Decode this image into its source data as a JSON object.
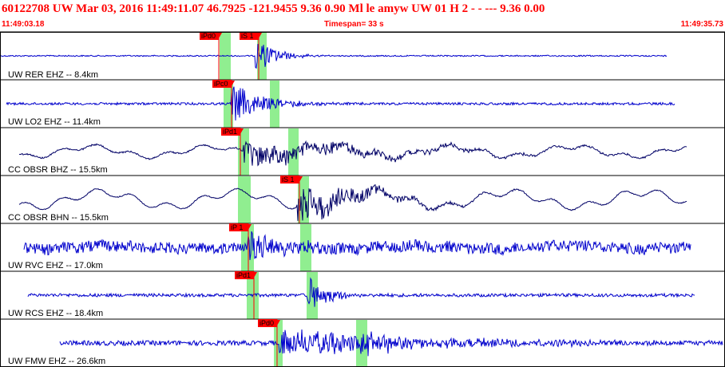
{
  "header": {
    "title": "60122708 UW Mar 03, 2016 11:49:11.07    46.7925 -121.9455  9.36 0.90 Ml le     amyw     UW 01 H    2  -  - ---   9.36 0.00",
    "start_time": "11:49:03.18",
    "timespan": "Timespan=  33 s",
    "end_time": "11:49:35.73"
  },
  "colors": {
    "header_text": "#ff0000",
    "trace_blue": "#0000cc",
    "trace_navy": "#000066",
    "pick_red": "#ff0000",
    "window_green": "#90ee90"
  },
  "traces": [
    {
      "label": "UW RER EHZ -- 8.4km",
      "color": "blue",
      "picks": [
        {
          "text": "iPd0",
          "at": 0.302
        },
        {
          "text": "iS 1",
          "at": 0.357
        }
      ]
    },
    {
      "label": "UW LO2 EHZ -- 11.4km",
      "color": "blue",
      "picks": [
        {
          "text": "iPc0",
          "at": 0.319
        }
      ]
    },
    {
      "label": "CC OBSR BHZ -- 15.5km",
      "color": "navy",
      "picks": [
        {
          "text": "iPd1",
          "at": 0.332
        }
      ]
    },
    {
      "label": "CC OBSR BHN -- 15.5km",
      "color": "navy",
      "picks": [
        {
          "text": "iS 1",
          "at": 0.413
        }
      ]
    },
    {
      "label": "UW RVC EHZ -- 17.0km",
      "color": "blue",
      "picks": [
        {
          "text": "iP 1",
          "at": 0.342
        }
      ]
    },
    {
      "label": "UW RCS EHZ -- 18.4km",
      "color": "blue",
      "picks": [
        {
          "text": "iPd1",
          "at": 0.35
        }
      ]
    },
    {
      "label": "UW FMW EHZ -- 26.6km",
      "color": "blue",
      "picks": [
        {
          "text": "iPd0",
          "at": 0.382
        }
      ]
    }
  ]
}
